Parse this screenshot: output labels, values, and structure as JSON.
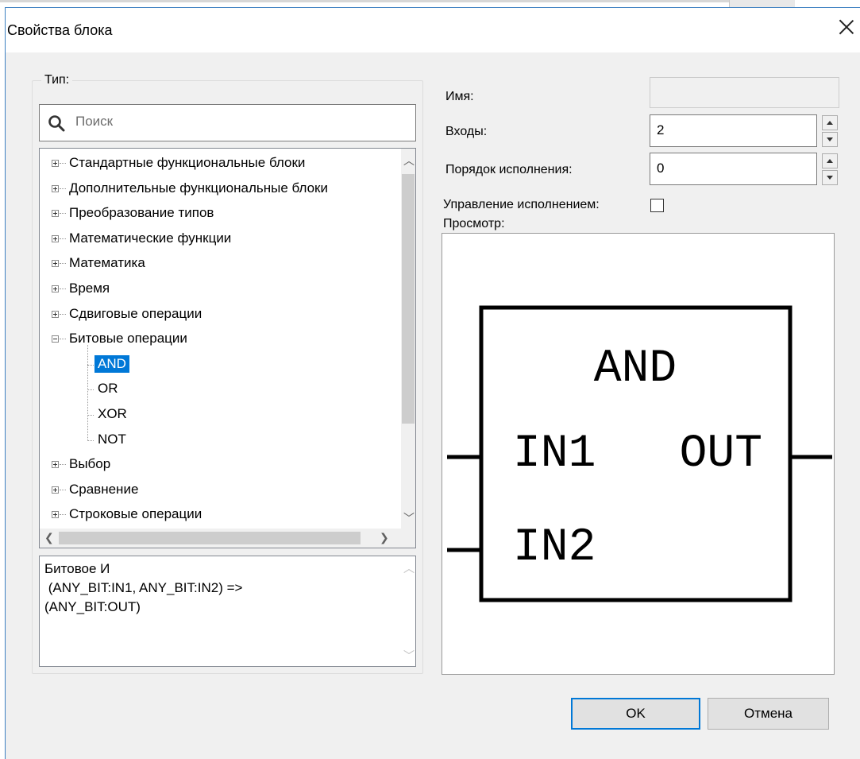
{
  "dialog": {
    "title": "Свойства блока"
  },
  "type_panel": {
    "label": "Тип:",
    "search_placeholder": "Поиск",
    "tree": [
      {
        "label": "Стандартные функциональные блоки",
        "expanded": false
      },
      {
        "label": "Дополнительные функциональные блоки",
        "expanded": false
      },
      {
        "label": "Преобразование типов",
        "expanded": false
      },
      {
        "label": "Математические функции",
        "expanded": false
      },
      {
        "label": "Математика",
        "expanded": false
      },
      {
        "label": "Время",
        "expanded": false
      },
      {
        "label": "Сдвиговые операции",
        "expanded": false
      },
      {
        "label": "Битовые операции",
        "expanded": true,
        "children": [
          "AND",
          "OR",
          "XOR",
          "NOT"
        ],
        "selected": "AND"
      },
      {
        "label": "Выбор",
        "expanded": false
      },
      {
        "label": "Сравнение",
        "expanded": false
      },
      {
        "label": "Строковые операции",
        "expanded": false
      }
    ],
    "description": "Битовое И\n (ANY_BIT:IN1, ANY_BIT:IN2) =>\n(ANY_BIT:OUT)"
  },
  "properties": {
    "name_label": "Имя:",
    "name_value": "",
    "inputs_label": "Входы:",
    "inputs_value": "2",
    "order_label": "Порядок исполнения:",
    "order_value": "0",
    "exec_control_label": "Управление исполнением:",
    "exec_control_checked": false,
    "preview_label": "Просмотр:"
  },
  "preview_block": {
    "name": "AND",
    "inputs": [
      "IN1",
      "IN2"
    ],
    "outputs": [
      "OUT"
    ]
  },
  "buttons": {
    "ok": "OK",
    "cancel": "Отмена"
  }
}
